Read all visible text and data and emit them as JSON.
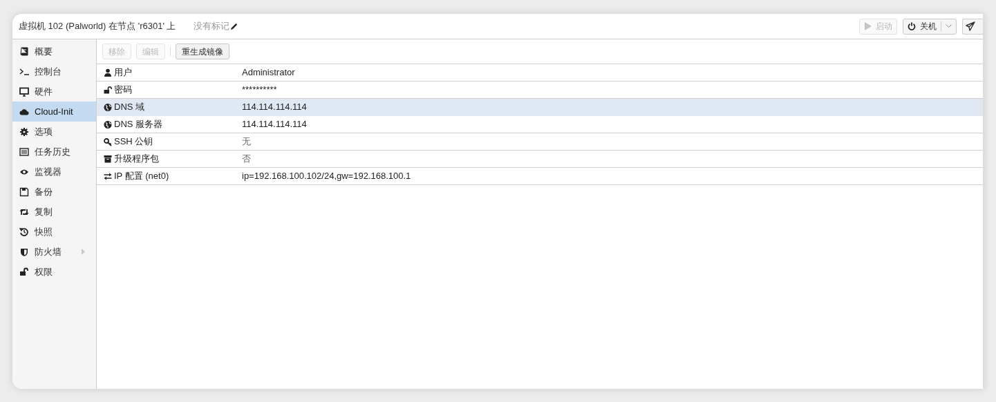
{
  "header": {
    "title": "虚拟机 102 (Palworld) 在节点 'r6301' 上",
    "tags": "没有标记",
    "buttons": [
      {
        "label": "启动",
        "disabled": true,
        "dropdown": false
      },
      {
        "label": "关机",
        "disabled": false,
        "dropdown": true
      }
    ]
  },
  "sidebar": {
    "items": [
      {
        "label": "概要",
        "selected": false,
        "has_submenu": false
      },
      {
        "label": "控制台",
        "selected": false,
        "has_submenu": false
      },
      {
        "label": "硬件",
        "selected": false,
        "has_submenu": false
      },
      {
        "label": "Cloud-Init",
        "selected": true,
        "has_submenu": false
      },
      {
        "label": "选项",
        "selected": false,
        "has_submenu": false
      },
      {
        "label": "任务历史",
        "selected": false,
        "has_submenu": false
      },
      {
        "label": "监视器",
        "selected": false,
        "has_submenu": false
      },
      {
        "label": "备份",
        "selected": false,
        "has_submenu": false
      },
      {
        "label": "复制",
        "selected": false,
        "has_submenu": false
      },
      {
        "label": "快照",
        "selected": false,
        "has_submenu": false
      },
      {
        "label": "防火墙",
        "selected": false,
        "has_submenu": true
      },
      {
        "label": "权限",
        "selected": false,
        "has_submenu": false
      }
    ]
  },
  "toolbar": [
    {
      "label": "移除",
      "disabled": true
    },
    {
      "label": "编辑",
      "disabled": true
    },
    {
      "label": "重生成镜像",
      "disabled": false
    }
  ],
  "table": {
    "rows": [
      {
        "key": "用户",
        "value": "Administrator",
        "selected": false,
        "muted": false
      },
      {
        "key": "密码",
        "value": "**********",
        "selected": false,
        "muted": false
      },
      {
        "key": "DNS 域",
        "value": "114.114.114.114",
        "selected": true,
        "muted": false
      },
      {
        "key": "DNS 服务器",
        "value": "114.114.114.114",
        "selected": false,
        "muted": false
      },
      {
        "key": "SSH 公钥",
        "value": "无",
        "selected": false,
        "muted": true
      },
      {
        "key": "升级程序包",
        "value": "否",
        "selected": false,
        "muted": true
      },
      {
        "key": "IP 配置 (net0)",
        "value": "ip=192.168.100.102/24,gw=192.168.100.1",
        "selected": false,
        "muted": false
      }
    ]
  }
}
